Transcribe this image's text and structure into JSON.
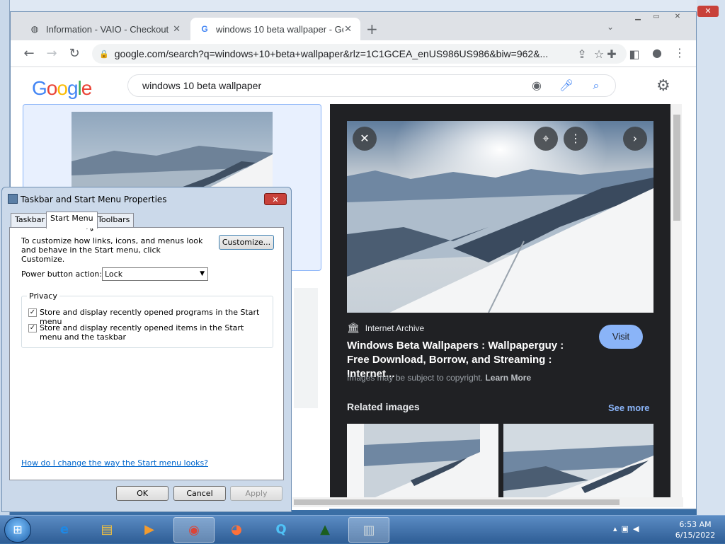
{
  "chrome": {
    "tabs": [
      {
        "title": "Information - VAIO - Checkout",
        "favicon": "globe-icon"
      },
      {
        "title": "windows 10 beta wallpaper - Go",
        "favicon": "google-g-icon"
      }
    ],
    "url": "google.com/search?q=windows+10+beta+wallpaper&rlz=1C1GCEA_enUS986US986&biw=962&..."
  },
  "google": {
    "logo": "Google",
    "query": "windows 10 beta wallpaper"
  },
  "preview": {
    "source": "Internet Archive",
    "title": "Windows Beta Wallpapers : Wallpaperguy : Free Download, Borrow, and Streaming : Internet...",
    "visit_label": "Visit",
    "copyright_text": "Images may be subject to copyright.",
    "learn_more": "Learn More",
    "related_heading": "Related images",
    "see_more": "See more"
  },
  "dialog": {
    "title": "Taskbar and Start Menu Properties",
    "tabs": [
      "Taskbar",
      "Start Menu",
      "Toolbars"
    ],
    "customize_text": "To customize how links, icons, and menus look and behave in the Start menu, click Customize.",
    "customize_button": "Customize...",
    "power_label": "Power button action:",
    "power_value": "Lock",
    "privacy_label": "Privacy",
    "checkbox1": "Store and display recently opened programs in the Start menu",
    "checkbox2": "Store and display recently opened items in the Start menu and the taskbar",
    "help_link": "How do I change the way the Start menu looks?",
    "ok": "OK",
    "cancel": "Cancel",
    "apply": "Apply"
  },
  "taskbar": {
    "time": "6:53 AM",
    "date": "6/15/2022"
  },
  "colors": {
    "panel_bg": "#202124",
    "visit_bg": "#8ab4f8",
    "link": "#0066cc",
    "taskbar": "#2e5d95"
  }
}
